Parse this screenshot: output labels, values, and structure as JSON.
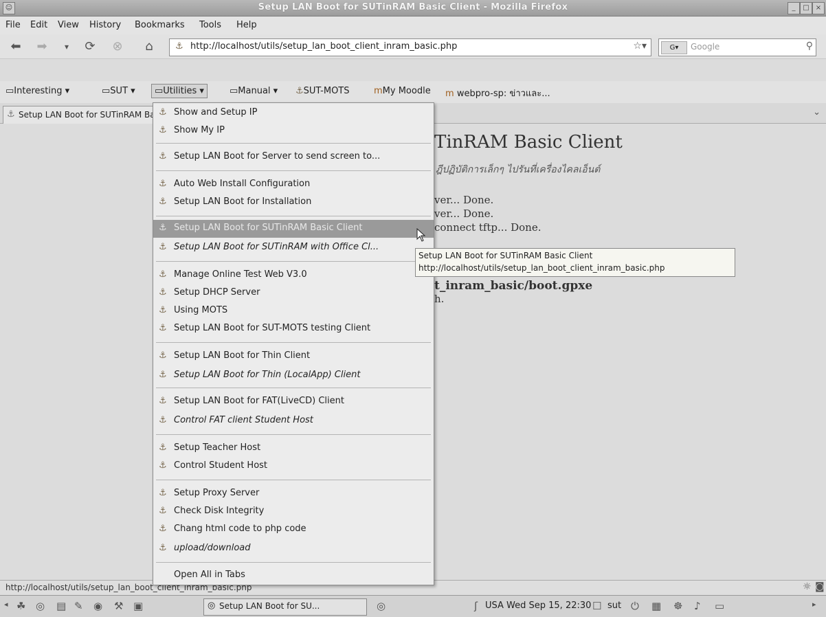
{
  "window": {
    "title": "Setup LAN Boot for SUTinRAM Basic Client - Mozilla Firefox"
  },
  "menubar": [
    "File",
    "Edit",
    "View",
    "History",
    "Bookmarks",
    "Tools",
    "Help"
  ],
  "navbar": {
    "url": "http://localhost/utils/setup_lan_boot_client_inram_basic.php",
    "search_placeholder": "Google"
  },
  "bookmarks": [
    {
      "label": "Interesting",
      "icon": "folder-icon"
    },
    {
      "label": "SUT",
      "icon": "folder-icon"
    },
    {
      "label": "Utilities",
      "icon": "folder-icon"
    },
    {
      "label": "Manual",
      "icon": "folder-icon"
    },
    {
      "label": "SUT-MOTS",
      "icon": "page-icon"
    },
    {
      "label": "My Moodle",
      "icon": "moodle-icon"
    },
    {
      "label": "webpro-sp: ข่าวและ...",
      "icon": "moodle-icon"
    }
  ],
  "tab": {
    "label": "Setup LAN Boot for SUTinRAM Basic Client"
  },
  "content": {
    "heading": "TinRAM Basic Client",
    "subheading": "ฎีปฏิบัติการเล็กๆ ไปรันที่เครื่องไคลเอ็นต์",
    "line1": "ver... Done.",
    "line2": "ver... Done.",
    "line3": "connect tftp... Done.",
    "line4": "t_inram_basic/boot.gpxe",
    "line5": "h."
  },
  "menu": {
    "items": [
      {
        "label": "Show and Setup IP",
        "italic": false
      },
      {
        "label": "Show My IP",
        "italic": false
      },
      {
        "label": "Setup LAN Boot for Server to send screen to...",
        "italic": false
      },
      {
        "label": "Auto Web Install Configuration",
        "italic": false
      },
      {
        "label": "Setup LAN Boot for Installation",
        "italic": false
      },
      {
        "label": "Setup LAN Boot for SUTinRAM Basic Client",
        "italic": false,
        "highlighted": true
      },
      {
        "label": "Setup LAN Boot for SUTinRAM with Office Cl...",
        "italic": true
      },
      {
        "label": "Manage Online Test Web V3.0",
        "italic": false
      },
      {
        "label": "Setup DHCP Server",
        "italic": false
      },
      {
        "label": "Using MOTS",
        "italic": false
      },
      {
        "label": "Setup LAN Boot for SUT-MOTS testing Client",
        "italic": false
      },
      {
        "label": "Setup LAN Boot for Thin Client",
        "italic": false
      },
      {
        "label": "Setup LAN Boot for Thin (LocalApp) Client",
        "italic": true
      },
      {
        "label": "Setup LAN Boot for FAT(LiveCD) Client",
        "italic": false
      },
      {
        "label": "Control FAT client Student Host",
        "italic": true
      },
      {
        "label": "Setup Teacher Host",
        "italic": false
      },
      {
        "label": "Control Student Host",
        "italic": false
      },
      {
        "label": "Setup Proxy Server",
        "italic": false
      },
      {
        "label": "Check Disk Integrity",
        "italic": false
      },
      {
        "label": "Chang html code to php code",
        "italic": false
      },
      {
        "label": "upload/download",
        "italic": true
      },
      {
        "label": "Open All in Tabs",
        "italic": false
      }
    ]
  },
  "tooltip": {
    "title": "Setup LAN Boot for SUTinRAM Basic Client",
    "url": "http://localhost/utils/setup_lan_boot_client_inram_basic.php"
  },
  "statusbar": {
    "text": "http://localhost/utils/setup_lan_boot_client_inram_basic.php"
  },
  "taskbar": {
    "window_label": "Setup LAN Boot for SU...",
    "clock": "USA Wed Sep 15, 22:30",
    "user": "sut"
  }
}
